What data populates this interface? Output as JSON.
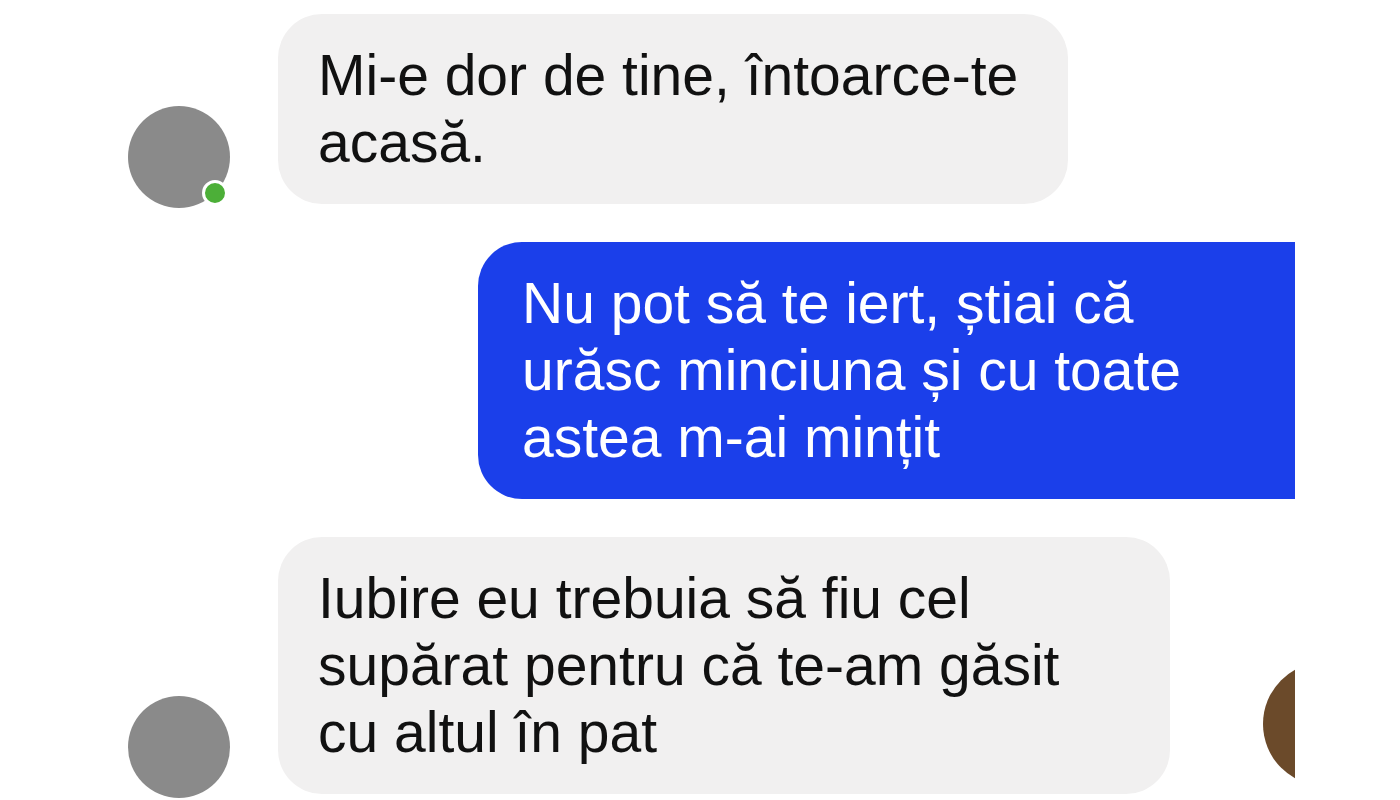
{
  "messages": [
    {
      "kind": "incoming",
      "text": "Mi-e dor de tine, întoarce-te acasă.",
      "avatar": {
        "online": true
      }
    },
    {
      "kind": "outgoing",
      "text": "Nu pot să te iert, știai că urăsc minciuna și cu toate astea m-ai mințit"
    },
    {
      "kind": "incoming",
      "text": "Iubire eu trebuia să fiu cel supărat pentru că te-am găsit cu altul în pat",
      "avatar": {
        "online": false
      },
      "seen": true
    }
  ]
}
